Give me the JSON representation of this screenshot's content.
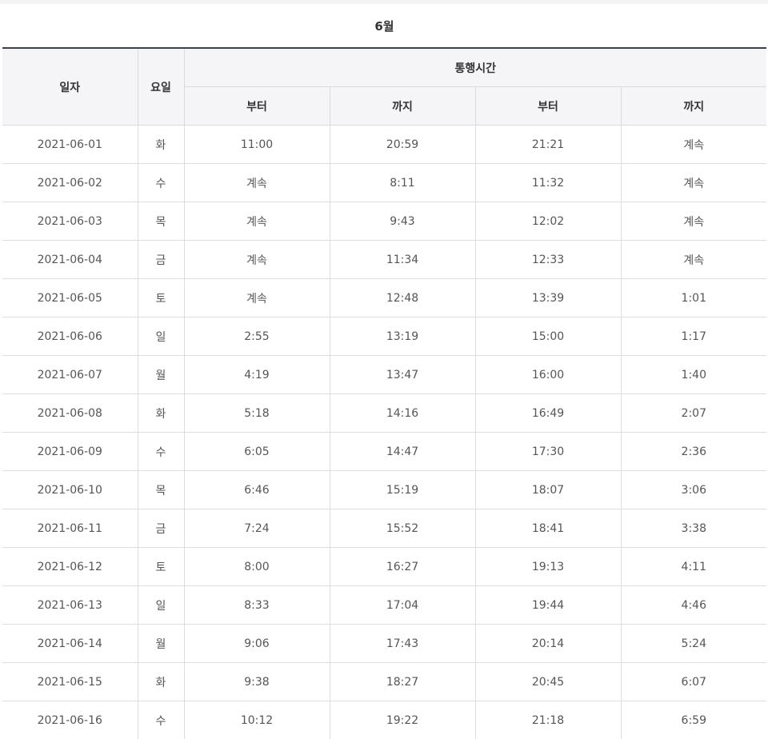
{
  "caption": "6월",
  "headers": {
    "date": "일자",
    "weekday": "요일",
    "passage": "통행시간",
    "from1": "부터",
    "to1": "까지",
    "from2": "부터",
    "to2": "까지"
  },
  "rows": [
    {
      "date": "2021-06-01",
      "weekday": "화",
      "from1": "11:00",
      "to1": "20:59",
      "from2": "21:21",
      "to2": "계속"
    },
    {
      "date": "2021-06-02",
      "weekday": "수",
      "from1": "계속",
      "to1": "8:11",
      "from2": "11:32",
      "to2": "계속"
    },
    {
      "date": "2021-06-03",
      "weekday": "목",
      "from1": "계속",
      "to1": "9:43",
      "from2": "12:02",
      "to2": "계속"
    },
    {
      "date": "2021-06-04",
      "weekday": "금",
      "from1": "계속",
      "to1": "11:34",
      "from2": "12:33",
      "to2": "계속"
    },
    {
      "date": "2021-06-05",
      "weekday": "토",
      "from1": "계속",
      "to1": "12:48",
      "from2": "13:39",
      "to2": "1:01"
    },
    {
      "date": "2021-06-06",
      "weekday": "일",
      "from1": "2:55",
      "to1": "13:19",
      "from2": "15:00",
      "to2": "1:17"
    },
    {
      "date": "2021-06-07",
      "weekday": "월",
      "from1": "4:19",
      "to1": "13:47",
      "from2": "16:00",
      "to2": "1:40"
    },
    {
      "date": "2021-06-08",
      "weekday": "화",
      "from1": "5:18",
      "to1": "14:16",
      "from2": "16:49",
      "to2": "2:07"
    },
    {
      "date": "2021-06-09",
      "weekday": "수",
      "from1": "6:05",
      "to1": "14:47",
      "from2": "17:30",
      "to2": "2:36"
    },
    {
      "date": "2021-06-10",
      "weekday": "목",
      "from1": "6:46",
      "to1": "15:19",
      "from2": "18:07",
      "to2": "3:06"
    },
    {
      "date": "2021-06-11",
      "weekday": "금",
      "from1": "7:24",
      "to1": "15:52",
      "from2": "18:41",
      "to2": "3:38"
    },
    {
      "date": "2021-06-12",
      "weekday": "토",
      "from1": "8:00",
      "to1": "16:27",
      "from2": "19:13",
      "to2": "4:11"
    },
    {
      "date": "2021-06-13",
      "weekday": "일",
      "from1": "8:33",
      "to1": "17:04",
      "from2": "19:44",
      "to2": "4:46"
    },
    {
      "date": "2021-06-14",
      "weekday": "월",
      "from1": "9:06",
      "to1": "17:43",
      "from2": "20:14",
      "to2": "5:24"
    },
    {
      "date": "2021-06-15",
      "weekday": "화",
      "from1": "9:38",
      "to1": "18:27",
      "from2": "20:45",
      "to2": "6:07"
    },
    {
      "date": "2021-06-16",
      "weekday": "수",
      "from1": "10:12",
      "to1": "19:22",
      "from2": "21:18",
      "to2": "6:59"
    }
  ]
}
